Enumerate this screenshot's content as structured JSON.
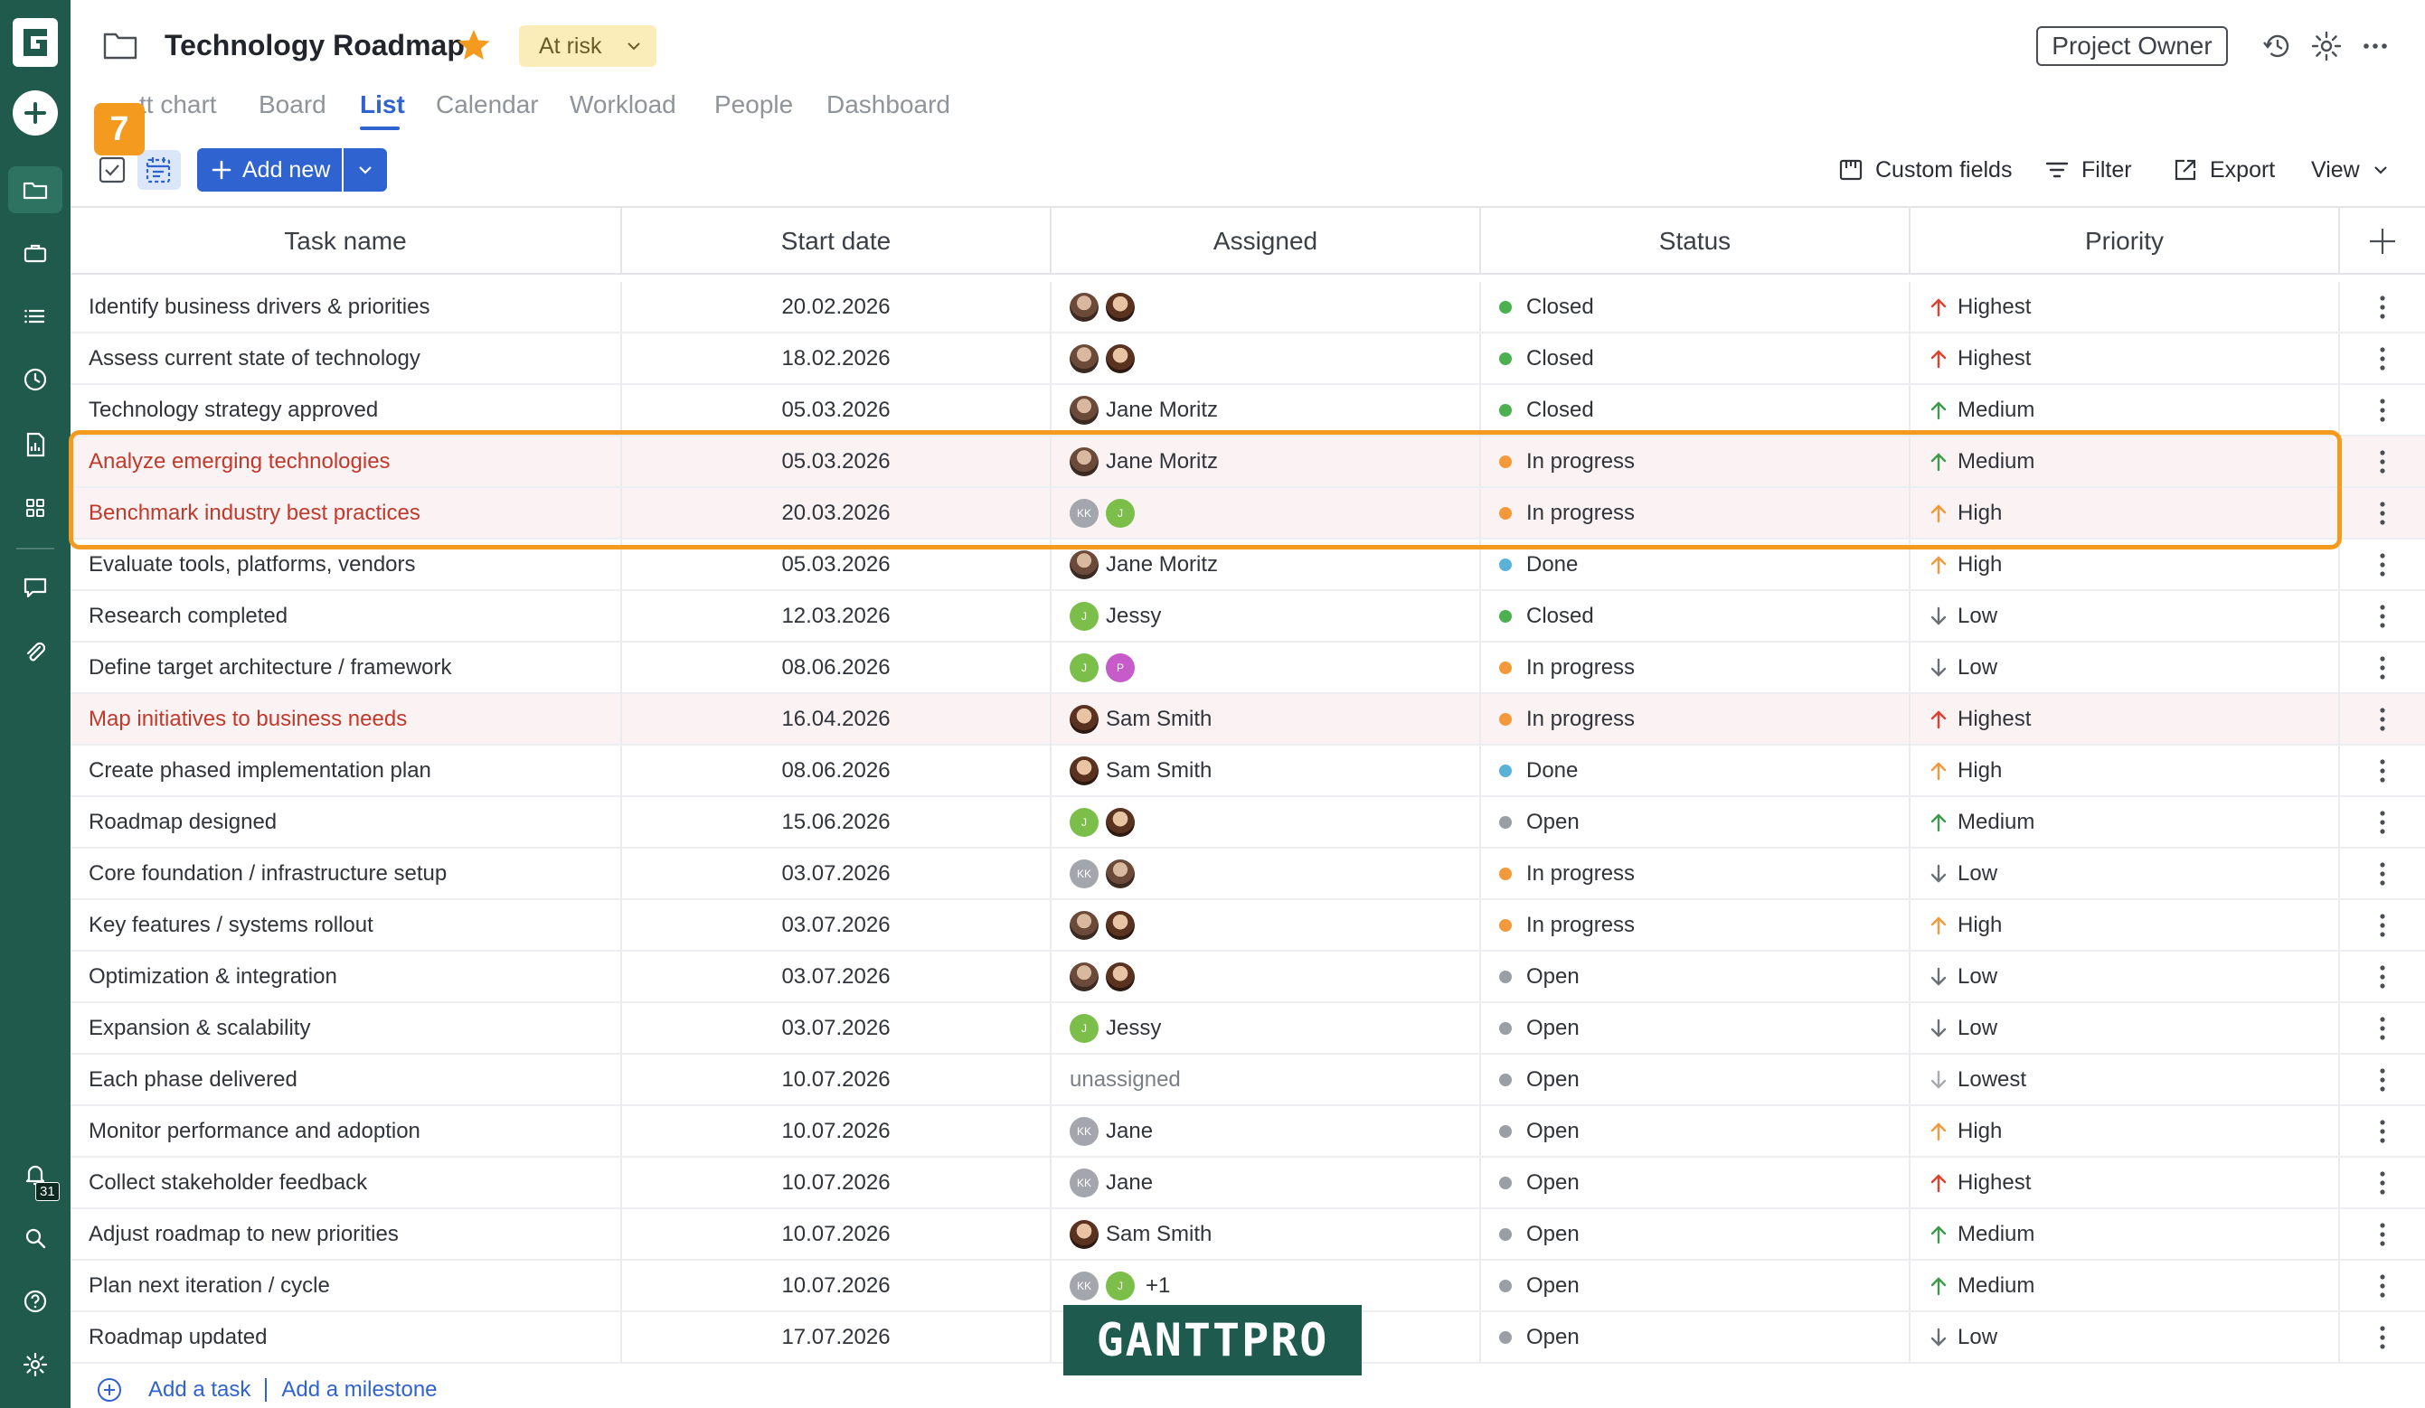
{
  "sidebar": {
    "notifications_count": "31"
  },
  "header": {
    "title": "Technology Roadmap",
    "status": "At risk",
    "owner_button": "Project Owner"
  },
  "tabs": [
    {
      "label": "tt chart"
    },
    {
      "label": "Board"
    },
    {
      "label": "List",
      "active": true
    },
    {
      "label": "Calendar"
    },
    {
      "label": "Workload"
    },
    {
      "label": "People"
    },
    {
      "label": "Dashboard"
    }
  ],
  "step_badge": "7",
  "toolbar": {
    "add_new": "Add new",
    "custom_fields": "Custom fields",
    "filter": "Filter",
    "export": "Export",
    "view": "View"
  },
  "columns": [
    "Task name",
    "Start date",
    "Assigned",
    "Status",
    "Priority"
  ],
  "rows": [
    {
      "task": "Identify business drivers & priorities",
      "date": "20.02.2026",
      "avatars": [
        "photo1",
        "photo2"
      ],
      "assignee": "",
      "status": "Closed",
      "priority": "Highest",
      "highlight": false
    },
    {
      "task": "Assess current state of technology",
      "date": "18.02.2026",
      "avatars": [
        "photo1",
        "photo2"
      ],
      "assignee": "",
      "status": "Closed",
      "priority": "Highest",
      "highlight": false
    },
    {
      "task": "Technology strategy approved",
      "date": "05.03.2026",
      "avatars": [
        "photo1"
      ],
      "assignee": "Jane Moritz",
      "status": "Closed",
      "priority": "Medium",
      "highlight": false
    },
    {
      "task": "Analyze emerging technologies",
      "date": "05.03.2026",
      "avatars": [
        "photo1"
      ],
      "assignee": "Jane Moritz",
      "status": "In progress",
      "priority": "Medium",
      "highlight": true
    },
    {
      "task": "Benchmark industry best practices",
      "date": "20.03.2026",
      "avatars": [
        "KK",
        "J"
      ],
      "assignee": "",
      "status": "In progress",
      "priority": "High",
      "highlight": true
    },
    {
      "task": "Evaluate tools, platforms, vendors",
      "date": "05.03.2026",
      "avatars": [
        "photo1"
      ],
      "assignee": "Jane Moritz",
      "status": "Done",
      "priority": "High",
      "highlight": false
    },
    {
      "task": "Research completed",
      "date": "12.03.2026",
      "avatars": [
        "J"
      ],
      "assignee": "Jessy",
      "status": "Closed",
      "priority": "Low",
      "highlight": false
    },
    {
      "task": "Define target architecture / framework",
      "date": "08.06.2026",
      "avatars": [
        "J",
        "P"
      ],
      "assignee": "",
      "status": "In progress",
      "priority": "Low",
      "highlight": false
    },
    {
      "task": "Map initiatives to business needs",
      "date": "16.04.2026",
      "avatars": [
        "photo2"
      ],
      "assignee": "Sam Smith",
      "status": "In progress",
      "priority": "Highest",
      "highlight": true
    },
    {
      "task": "Create phased implementation plan",
      "date": "08.06.2026",
      "avatars": [
        "photo2"
      ],
      "assignee": "Sam Smith",
      "status": "Done",
      "priority": "High",
      "highlight": false
    },
    {
      "task": "Roadmap designed",
      "date": "15.06.2026",
      "avatars": [
        "J",
        "photo2"
      ],
      "assignee": "",
      "status": "Open",
      "priority": "Medium",
      "highlight": false
    },
    {
      "task": "Core foundation / infrastructure setup",
      "date": "03.07.2026",
      "avatars": [
        "KK",
        "photo1"
      ],
      "assignee": "",
      "status": "In progress",
      "priority": "Low",
      "highlight": false
    },
    {
      "task": "Key features / systems rollout",
      "date": "03.07.2026",
      "avatars": [
        "photo1",
        "photo2"
      ],
      "assignee": "",
      "status": "In progress",
      "priority": "High",
      "highlight": false
    },
    {
      "task": "Optimization & integration",
      "date": "03.07.2026",
      "avatars": [
        "photo1",
        "photo2"
      ],
      "assignee": "",
      "status": "Open",
      "priority": "Low",
      "highlight": false
    },
    {
      "task": "Expansion & scalability",
      "date": "03.07.2026",
      "avatars": [
        "J"
      ],
      "assignee": "Jessy",
      "status": "Open",
      "priority": "Low",
      "highlight": false
    },
    {
      "task": "Each phase delivered",
      "date": "10.07.2026",
      "avatars": [],
      "assignee": "unassigned",
      "status": "Open",
      "priority": "Lowest",
      "highlight": false
    },
    {
      "task": "Monitor performance and adoption",
      "date": "10.07.2026",
      "avatars": [
        "KK"
      ],
      "assignee": "Jane",
      "status": "Open",
      "priority": "High",
      "highlight": false
    },
    {
      "task": "Collect stakeholder feedback",
      "date": "10.07.2026",
      "avatars": [
        "KK"
      ],
      "assignee": "Jane",
      "status": "Open",
      "priority": "Highest",
      "highlight": false
    },
    {
      "task": "Adjust roadmap to new priorities",
      "date": "10.07.2026",
      "avatars": [
        "photo2"
      ],
      "assignee": "Sam Smith",
      "status": "Open",
      "priority": "Medium",
      "highlight": false
    },
    {
      "task": "Plan next iteration / cycle",
      "date": "10.07.2026",
      "avatars": [
        "KK",
        "J"
      ],
      "assignee": "+1",
      "status": "Open",
      "priority": "Medium",
      "highlight": false
    },
    {
      "task": "Roadmap updated",
      "date": "17.07.2026",
      "avatars": [],
      "assignee": "",
      "status": "Open",
      "priority": "Low",
      "highlight": false
    }
  ],
  "status_colors": {
    "Closed": "#4caf50",
    "In progress": "#f29a3b",
    "Done": "#5ab2d8",
    "Open": "#9a9ea5"
  },
  "priority_styles": {
    "Highest": {
      "dir": "up",
      "color": "#e0412f"
    },
    "High": {
      "dir": "up",
      "color": "#f29a3b"
    },
    "Medium": {
      "dir": "up",
      "color": "#3d9a4a"
    },
    "Low": {
      "dir": "down",
      "color": "#6b7078"
    },
    "Lowest": {
      "dir": "down",
      "color": "#a7abb1"
    }
  },
  "footer": {
    "add_task": "Add a task",
    "add_milestone": "Add a milestone"
  },
  "watermark": "GANTTPRO"
}
